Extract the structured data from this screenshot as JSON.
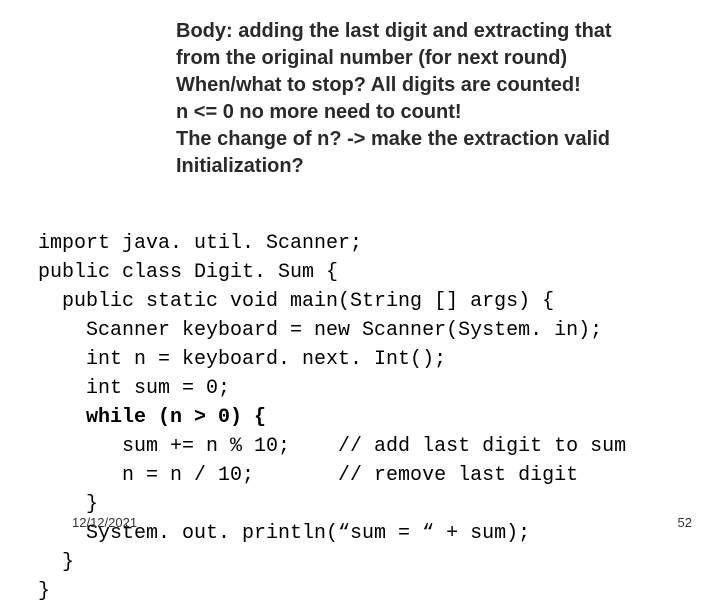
{
  "annotation": {
    "line1": "Body: adding the last digit and extracting that",
    "line2": "from the original number (for next round)",
    "line3": "When/what to stop? All digits are counted!",
    "line4": "n <= 0  no more need to count!",
    "line5": "The change of n? -> make the extraction valid",
    "line6": "Initialization?"
  },
  "code": {
    "l1": "import java. util. Scanner;",
    "l2": "public class Digit. Sum {",
    "l3": "  public static void main(String [] args) {",
    "l4": "    Scanner keyboard = new Scanner(System. in);",
    "l5": "    int n = keyboard. next. Int();",
    "l6": "    int sum = 0;",
    "l7a": "    ",
    "l7b": "while (n > 0) {",
    "l8": "       sum += n % 10;    // add last digit to sum",
    "l9": "       n = n / 10;       // remove last digit",
    "l10": "    }",
    "l11": "    System. out. println(“sum = “ + sum);",
    "l12": "  }",
    "l13": "}"
  },
  "footer": {
    "date": "12/12/2021",
    "page": "52"
  }
}
